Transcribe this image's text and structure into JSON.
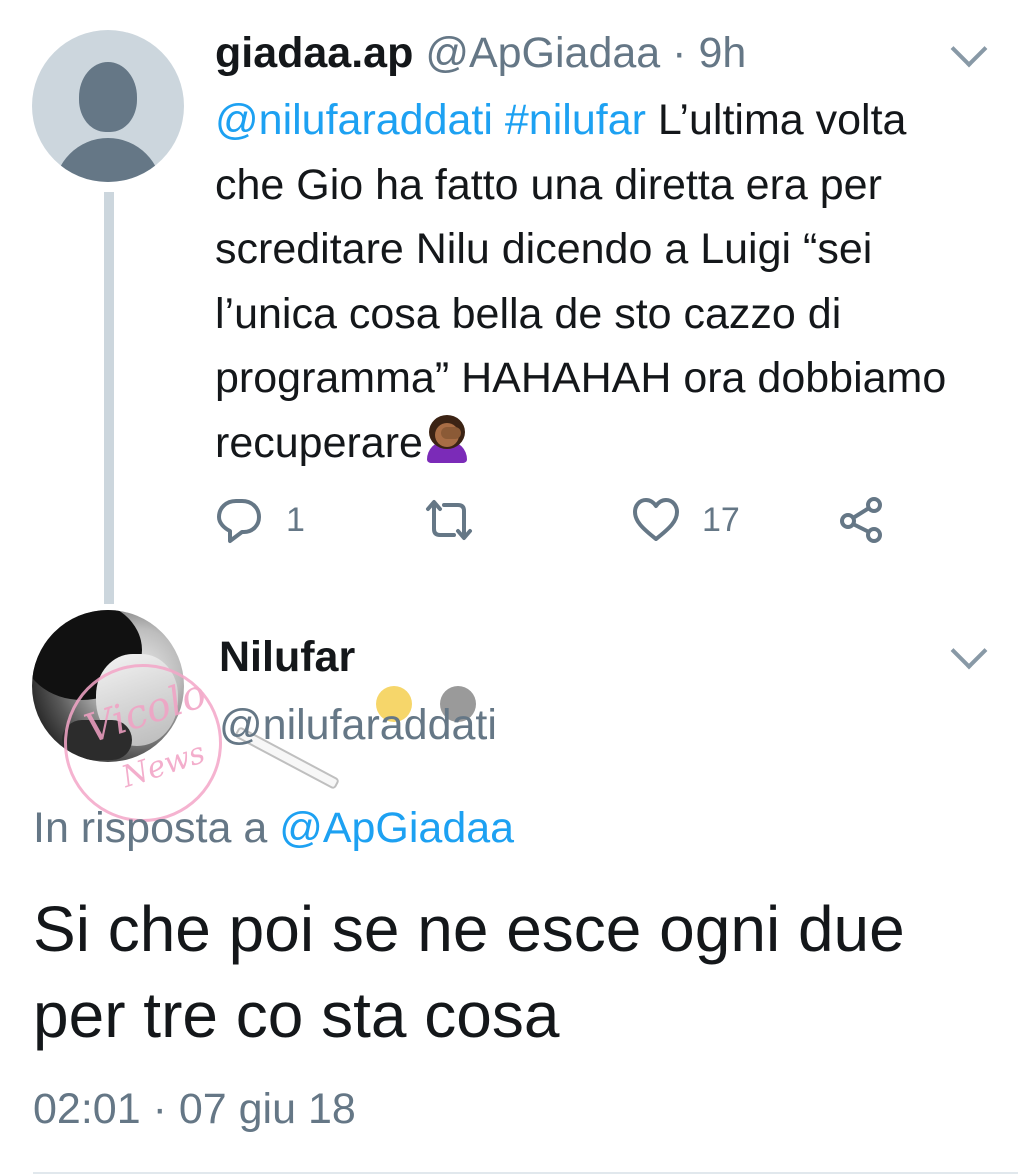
{
  "parent_tweet": {
    "display_name": "giadaa.ap",
    "handle": "@ApGiadaa",
    "separator": "·",
    "time_ago": "9h",
    "mention": "@nilufaraddati",
    "hashtag": "#nilufar",
    "text": "L’ultima volta che Gio ha fatto una diretta era per screditare Nilu dicendo a Luigi “sei l’unica cosa bella de sto cazzo di programma” HAHAHAH ora dobbiamo recuperare",
    "emoji": "person-facepalming",
    "actions": {
      "reply_count": "1",
      "retweet_count": "",
      "like_count": "17"
    }
  },
  "reply_tweet": {
    "display_name": "Nilufar",
    "handle": "@nilufaraddati",
    "in_reply_prefix": "In risposta a",
    "in_reply_handle": "@ApGiadaa",
    "text": "Si che poi se ne esce ogni due per tre co sta cosa",
    "time": "02:01",
    "separator": "·",
    "date": "07 giu 18"
  },
  "watermark": {
    "line1": "Vicolo",
    "line2": "News"
  },
  "colors": {
    "link": "#1da1f2",
    "secondary_text": "#657786",
    "primary_text": "#14171a",
    "thread_line": "#ccd6dd"
  }
}
